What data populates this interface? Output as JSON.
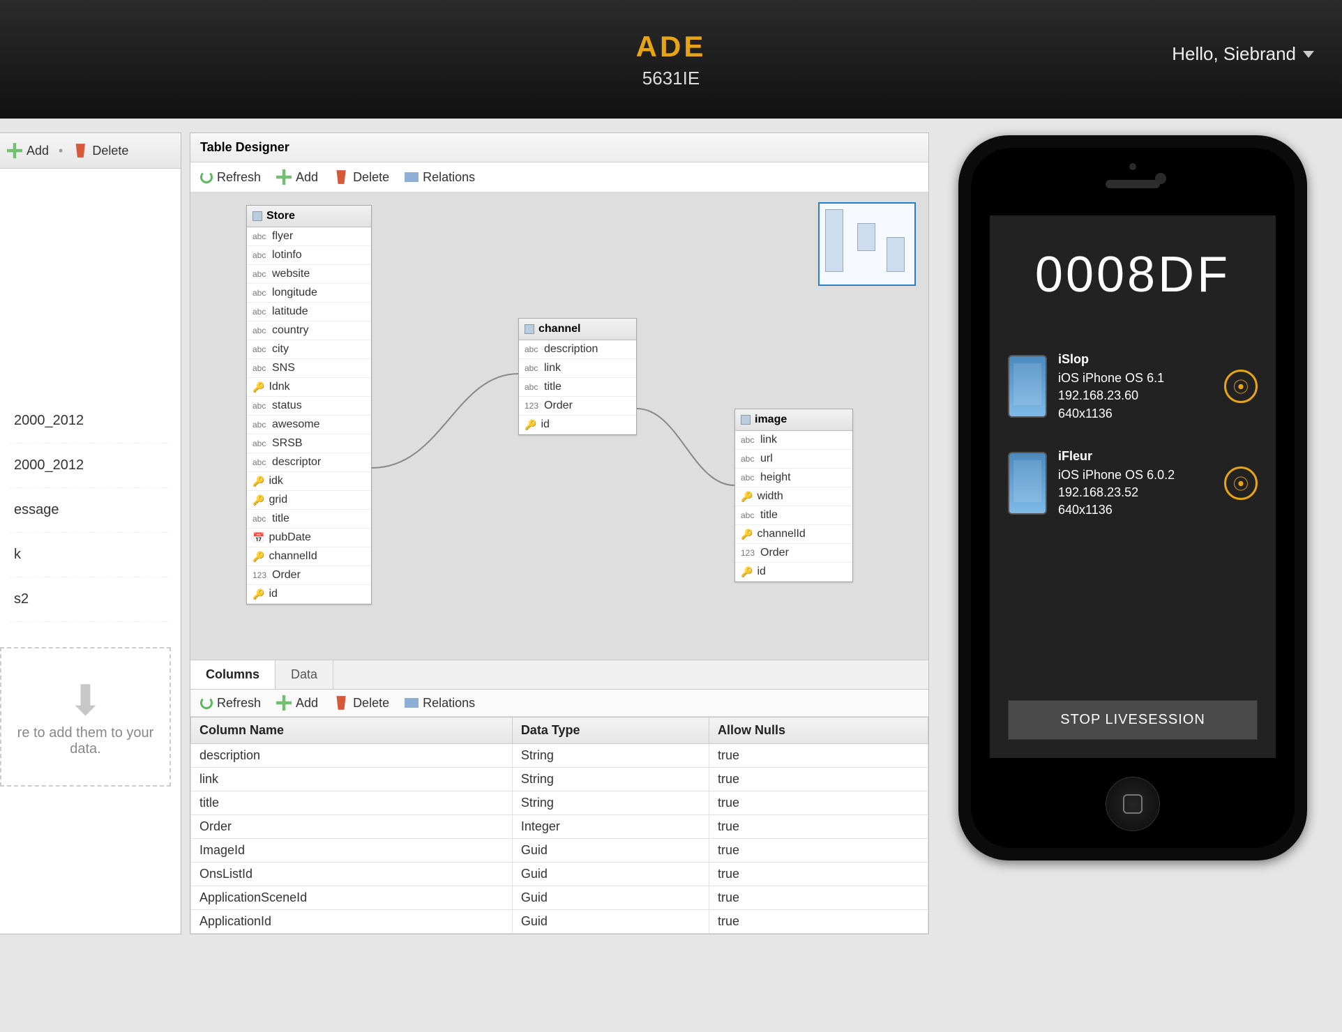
{
  "header": {
    "title": "ADE",
    "subtitle": "5631IE",
    "user_greeting": "Hello, Siebrand"
  },
  "left": {
    "toolbar": {
      "add": "Add",
      "delete": "Delete"
    },
    "items": [
      "2000_2012",
      "2000_2012",
      "essage",
      "k",
      "s2"
    ],
    "dropzone_hint": "re to add them to your data."
  },
  "designer": {
    "title": "Table Designer",
    "toolbar": {
      "refresh": "Refresh",
      "add": "Add",
      "delete": "Delete",
      "relations": "Relations"
    },
    "entities": {
      "store": {
        "name": "Store",
        "fields": [
          "flyer",
          "lotinfo",
          "website",
          "longitude",
          "latitude",
          "country",
          "city",
          "SNS",
          "Idnk",
          "status",
          "awesome",
          "SRSB",
          "descriptor",
          "idk",
          "grid",
          "title",
          "pubDate",
          "channelId",
          "Order",
          "id"
        ]
      },
      "channel": {
        "name": "channel",
        "fields": [
          "description",
          "link",
          "title",
          "Order",
          "id"
        ]
      },
      "image": {
        "name": "image",
        "fields": [
          "link",
          "url",
          "height",
          "width",
          "title",
          "channelId",
          "Order",
          "id"
        ]
      }
    },
    "tabs": {
      "columns": "Columns",
      "data": "Data"
    },
    "grid_toolbar": {
      "refresh": "Refresh",
      "add": "Add",
      "delete": "Delete",
      "relations": "Relations"
    },
    "grid": {
      "headers": [
        "Column Name",
        "Data Type",
        "Allow Nulls"
      ],
      "rows": [
        [
          "description",
          "String",
          "true"
        ],
        [
          "link",
          "String",
          "true"
        ],
        [
          "title",
          "String",
          "true"
        ],
        [
          "Order",
          "Integer",
          "true"
        ],
        [
          "ImageId",
          "Guid",
          "true"
        ],
        [
          "OnsListId",
          "Guid",
          "true"
        ],
        [
          "ApplicationSceneId",
          "Guid",
          "true"
        ],
        [
          "ApplicationId",
          "Guid",
          "true"
        ]
      ]
    }
  },
  "phone": {
    "code": "0008DF",
    "devices": [
      {
        "name": "iSlop",
        "os": "iOS iPhone OS 6.1",
        "ip": "192.168.23.60",
        "res": "640x1136"
      },
      {
        "name": "iFleur",
        "os": "iOS iPhone OS 6.0.2",
        "ip": "192.168.23.52",
        "res": "640x1136"
      }
    ],
    "stop": "STOP LIVESESSION"
  }
}
